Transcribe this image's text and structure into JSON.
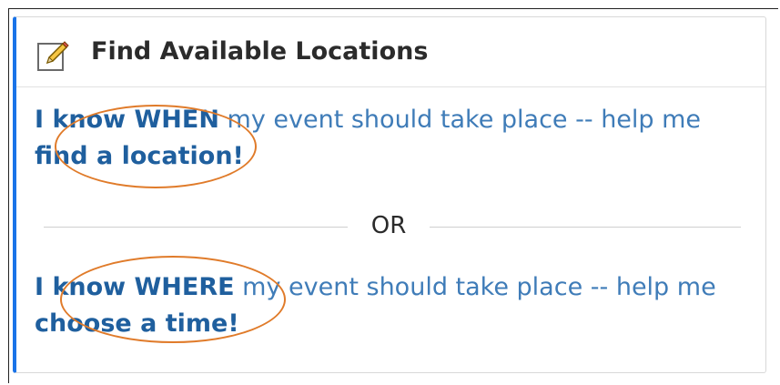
{
  "panel": {
    "title": "Find Available Locations",
    "title_icon": "edit-pencil-icon",
    "accent_color": "#1a73e8"
  },
  "options": [
    {
      "link_part1": "I know WHEN",
      "text_part": " my event should take place -- help me ",
      "link_part2": "find a location!"
    },
    {
      "link_part1": "I know WHERE",
      "text_part": " my event should take place -- help me ",
      "link_part2": "choose a time!"
    }
  ],
  "divider": {
    "label": "OR"
  },
  "annotations": {
    "highlight_color": "#e07b2a"
  }
}
